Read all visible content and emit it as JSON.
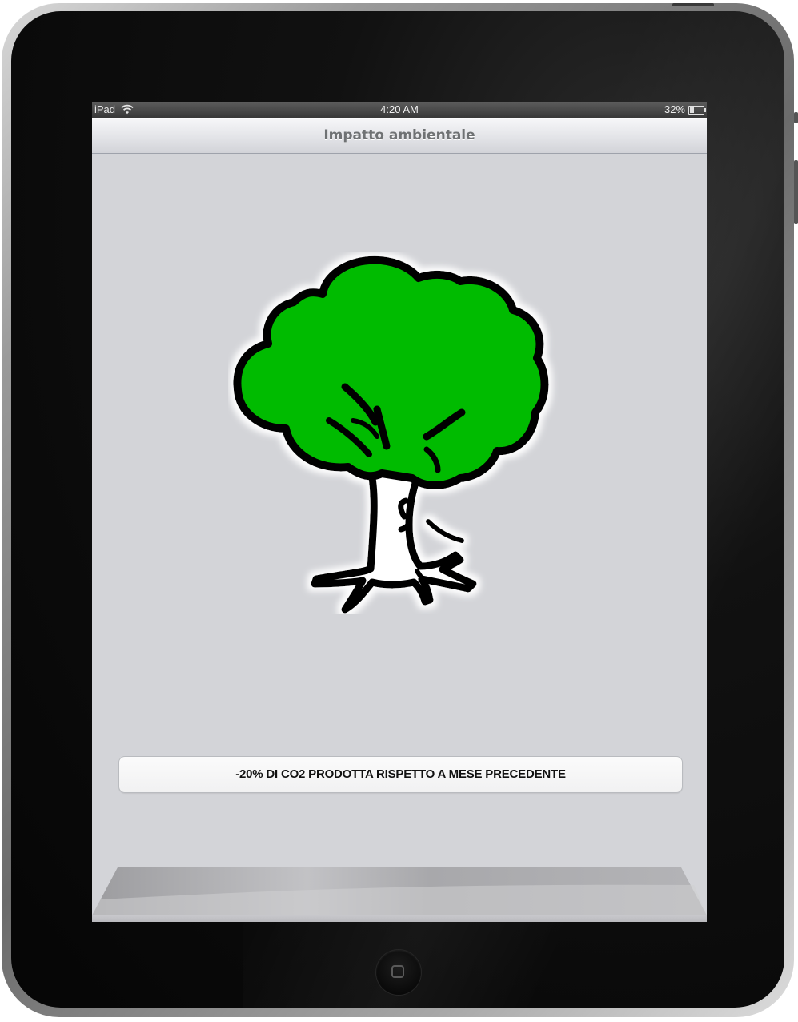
{
  "status_bar": {
    "carrier": "iPad",
    "time": "4:20 AM",
    "battery_percent": "32%",
    "battery_level": 0.32,
    "wifi_icon": "wifi-icon",
    "battery_icon": "battery-icon"
  },
  "nav_bar": {
    "title": "Impatto ambientale"
  },
  "main": {
    "illustration": "tree-icon",
    "message": "-20% DI CO2 PRODOTTA RISPETTO A MESE PRECEDENTE"
  },
  "colors": {
    "tree_foliage": "#00bb00",
    "screen_background": "#d3d4d8",
    "title_text": "#6f7274"
  }
}
